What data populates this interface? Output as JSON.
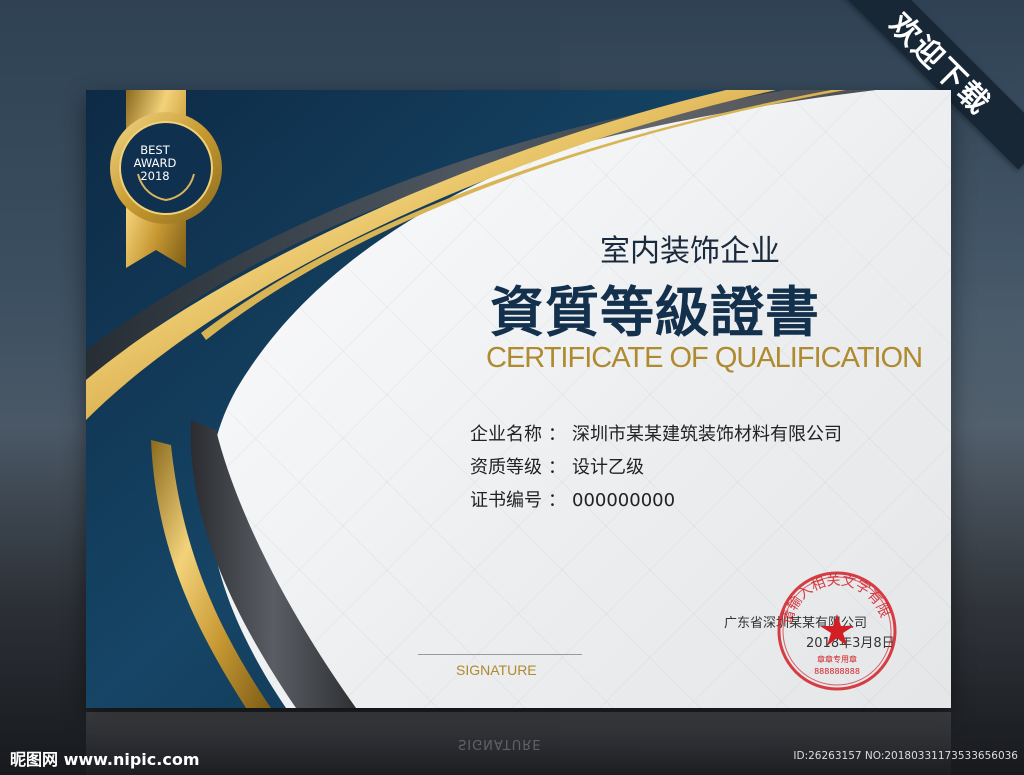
{
  "banner": {
    "text": "欢迎下载"
  },
  "badge": {
    "line1": "BEST",
    "line2": "AWARD",
    "line3": "2018"
  },
  "certificate": {
    "subtitle": "室内装饰企业",
    "title": "資質等級證書",
    "title_en": "CERTIFICATE OF QUALIFICATION",
    "fields": [
      {
        "label": "企业名称",
        "value": "深圳市某某建筑装饰材料有限公司"
      },
      {
        "label": "资质等级",
        "value": "设计乙级"
      },
      {
        "label": "证书编号",
        "value": "000000000"
      }
    ],
    "separator": "：",
    "issuer": "广东省深圳某某有限公司",
    "date": "2018年3月8日",
    "signature_label": "SIGNATURE"
  },
  "stamp": {
    "ring_text": "请输入相关文字有限",
    "small_text": "章章专用章",
    "number": "888888888"
  },
  "colors": {
    "navy": "#13304c",
    "gold": "#b08a2e",
    "stamp_red": "#d21f26"
  },
  "watermark": {
    "logo": "昵图网 www.nipic.com",
    "id": "ID:26263157 NO:20180331173533656036"
  }
}
